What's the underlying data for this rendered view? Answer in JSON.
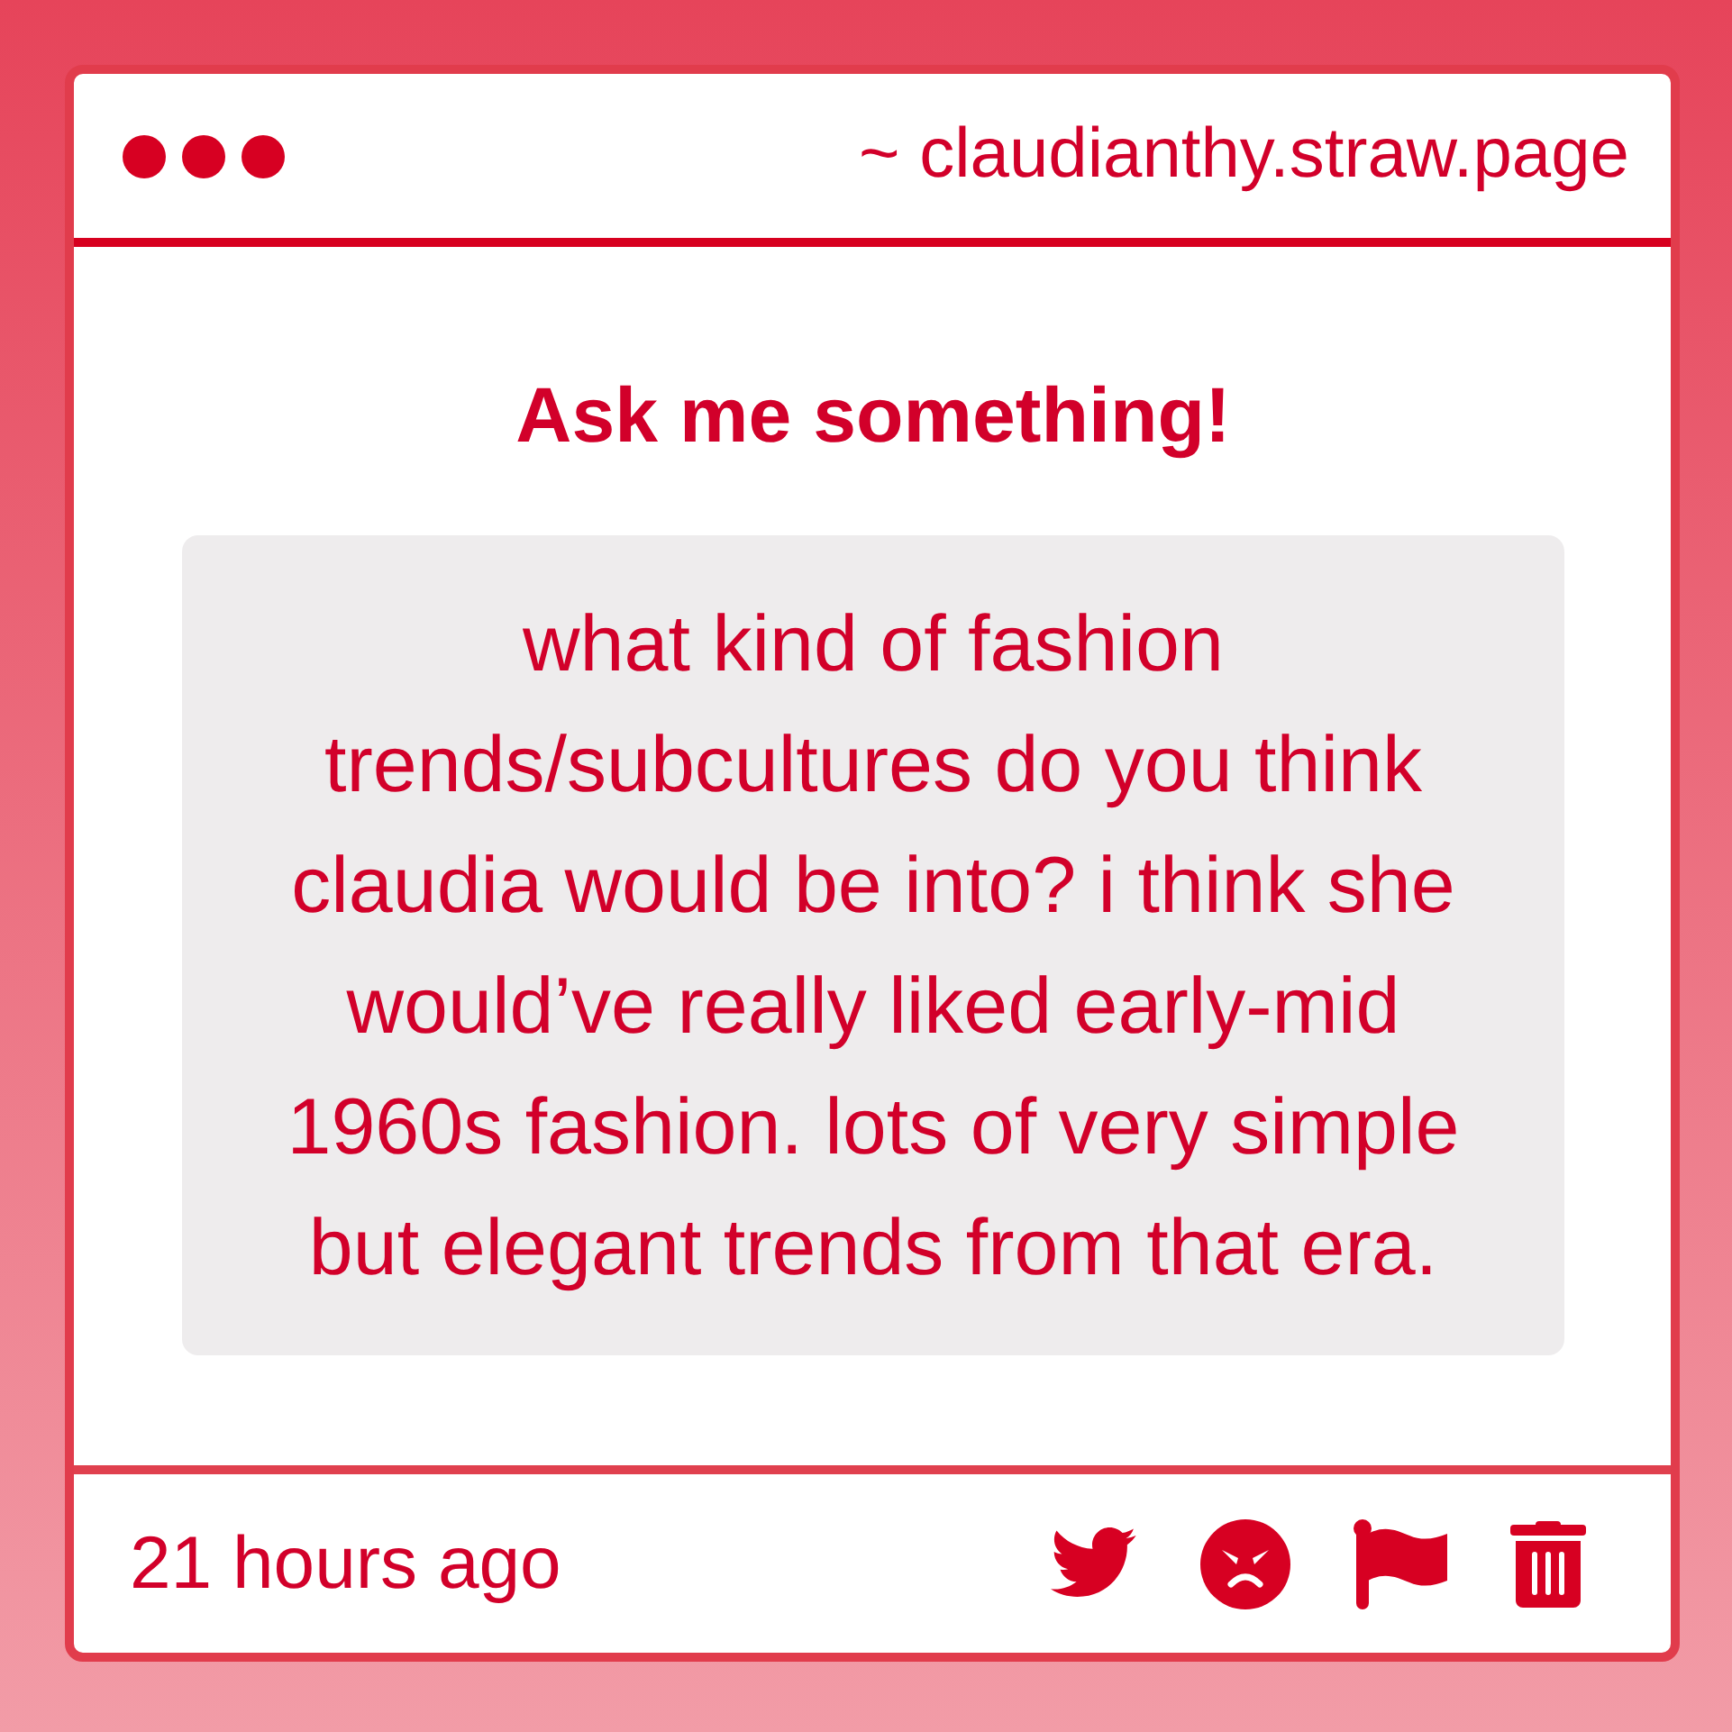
{
  "window": {
    "address": "~ claudianthy.straw.page"
  },
  "prompt": {
    "title": "Ask me something!"
  },
  "question": {
    "text": "what kind of fashion\ntrends/subcultures do you think\nclaudia would be into? i think she\nwould’ve really liked early-mid\n1960s fashion. lots of very simple\nbut elegant trends from that era."
  },
  "footer": {
    "time": "21 hours ago",
    "actions": [
      {
        "kind": "twitter"
      },
      {
        "kind": "angry"
      },
      {
        "kind": "flag"
      },
      {
        "kind": "trash"
      }
    ]
  }
}
